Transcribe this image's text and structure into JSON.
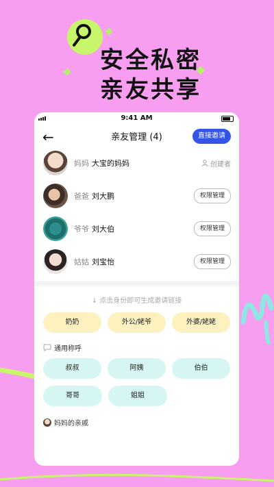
{
  "hero": {
    "line1": "安全私密",
    "line2": "亲友共享"
  },
  "status": {
    "time": "9:41 AM"
  },
  "nav": {
    "title": "亲友管理 (4)",
    "invite_label": "直接邀请"
  },
  "members": [
    {
      "relation": "妈妈",
      "name": "大宝的妈妈",
      "right": "创建者"
    },
    {
      "relation": "爸爸",
      "name": "刘大鹏",
      "right": "权限管理"
    },
    {
      "relation": "爷爷",
      "name": "刘大伯",
      "right": "权限管理"
    },
    {
      "relation": "姑姑",
      "name": "刘宝怡",
      "right": "权限管理"
    }
  ],
  "hint": "点击身份即可生成邀请链接",
  "family_roles": [
    "奶奶",
    "外公/姥爷",
    "外婆/姥姥"
  ],
  "common_section": {
    "title": "通用称呼",
    "items": [
      "叔叔",
      "阿姨",
      "伯伯",
      "哥哥",
      "姐姐"
    ]
  },
  "mom_relatives": {
    "title": "妈妈的亲戚"
  },
  "colors": {
    "background": "#f79ef0",
    "accent_blue": "#3454e8",
    "yellow_pill": "#fdf1bf",
    "mint_pill": "#d5f6f2"
  }
}
